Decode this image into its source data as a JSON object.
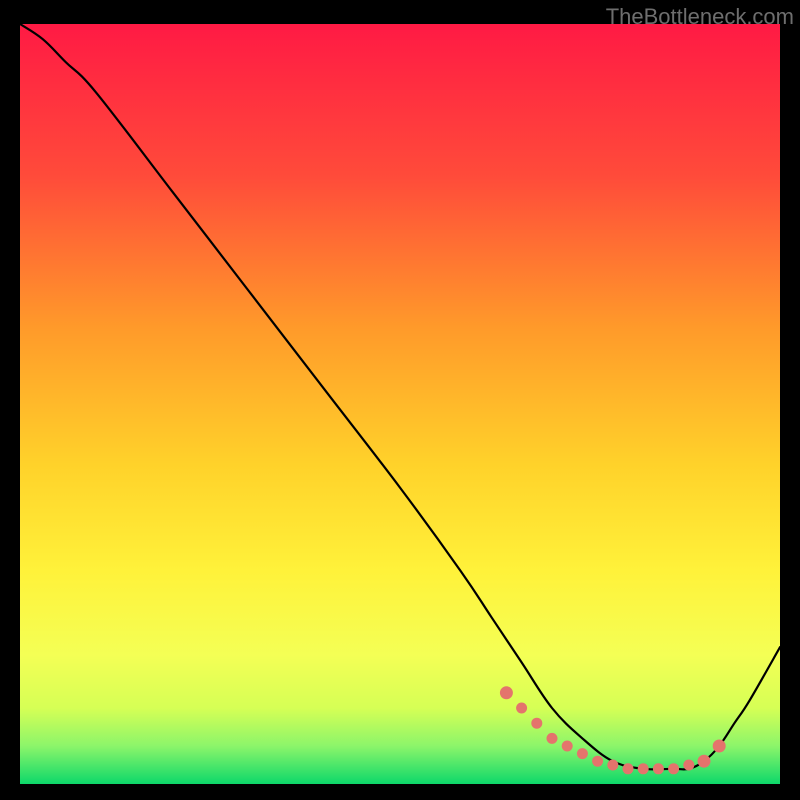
{
  "watermark": "TheBottleneck.com",
  "colors": {
    "background": "#000000",
    "curve": "#000000",
    "markers": "#e4746c",
    "gradient_top": "#ff1a44",
    "gradient_mid1": "#ff8a2a",
    "gradient_mid2": "#ffe02a",
    "gradient_mid3": "#f4ff55",
    "gradient_bottom": "#0dd86a"
  },
  "chart_data": {
    "type": "line",
    "title": "",
    "xlabel": "",
    "ylabel": "",
    "xlim": [
      0,
      100
    ],
    "ylim": [
      0,
      100
    ],
    "grid": false,
    "legend": false,
    "series": [
      {
        "name": "curve",
        "x": [
          0,
          3,
          6,
          10,
          20,
          30,
          40,
          50,
          58,
          62,
          66,
          70,
          74,
          78,
          82,
          86,
          88,
          90,
          92,
          94,
          96,
          100
        ],
        "y": [
          100,
          98,
          95,
          91,
          78,
          65,
          52,
          39,
          28,
          22,
          16,
          10,
          6,
          3,
          2,
          2,
          2,
          3,
          5,
          8,
          11,
          18
        ]
      }
    ],
    "markers": {
      "name": "highlight-dots",
      "x": [
        64,
        66,
        68,
        70,
        72,
        74,
        76,
        78,
        80,
        82,
        84,
        86,
        88,
        90,
        92
      ],
      "y": [
        12,
        10,
        8,
        6,
        5,
        4,
        3,
        2.5,
        2,
        2,
        2,
        2,
        2.5,
        3,
        5
      ]
    }
  }
}
